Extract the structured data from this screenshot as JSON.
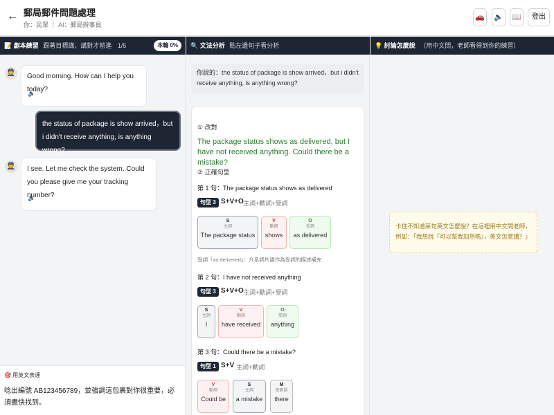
{
  "header": {
    "back_icon": "←",
    "title": "郵局郵件問題處理",
    "subtitle": "你：民眾 ｜ AI：郵局辦事員",
    "icons": [
      "🚗",
      "🔈",
      "📖"
    ],
    "logout_label": "登出"
  },
  "left": {
    "head_icon": "📝",
    "head_title": "劇本練習",
    "head_sub": "跟著目標講，講對才前進",
    "page": "1/5",
    "progress_label": "本輪 0%",
    "messages": [
      {
        "role": "ai",
        "avatar": "👮",
        "text": "Good morning. How can I help you today?",
        "speak": "🔈"
      },
      {
        "role": "user",
        "text": "the status of package is show arrived，but i didn't receive anything, is anything wrong?"
      },
      {
        "role": "ai",
        "avatar": "👮",
        "text": "I see. Let me check the system. Could you please give me your tracking number?",
        "speak": "🔈"
      }
    ],
    "english_label": "🎯 用英文表達",
    "english_prompt": "唸出編號 AB123456789，並強調這包裹對你很重要，必須盡快找到。"
  },
  "middle": {
    "head_icon": "🔍",
    "head_title": "文法分析",
    "head_sub": "點左邊句子看分析",
    "you_said": "你說的：the status of package is show arrived，but i didn't receive anything, is anything wrong?",
    "section1": "① 改對",
    "corrected": "The package status shows as delivered, but I have not received anything. Could there be a mistake?",
    "section2": "② 正確句型",
    "sentences": [
      {
        "label": "第 1 句：The package status shows as delivered",
        "pattern_tag": "句型 3",
        "formula": "S+V+O",
        "formula_cn": "主詞+動詞+受詞",
        "chips": [
          {
            "key": "S",
            "role": "主詞",
            "word": "The package status"
          },
          {
            "key": "V",
            "role": "動詞",
            "word": "shows"
          },
          {
            "key": "O",
            "role": "受詞",
            "word": "as delivered"
          }
        ],
        "note": "受詞「as delivered」：介系詞片語作為受詞的描述補充"
      },
      {
        "label": "第 2 句：I have not received anything",
        "pattern_tag": "句型 3",
        "formula": "S+V+O",
        "formula_cn": "主詞+動詞+受詞",
        "chips": [
          {
            "key": "S",
            "role": "主詞",
            "word": "I"
          },
          {
            "key": "V",
            "role": "動詞",
            "word": "have received"
          },
          {
            "key": "O",
            "role": "受詞",
            "word": "anything"
          }
        ]
      },
      {
        "label": "第 3 句：Could there be a mistake?",
        "pattern_tag": "句型 1",
        "formula": "S+V",
        "formula_cn": "主詞+動詞",
        "chips": [
          {
            "key": "V",
            "role": "動詞",
            "word": "Could be"
          },
          {
            "key": "S",
            "role": "主詞",
            "word": "a mistake"
          },
          {
            "key": "M",
            "role": "修飾語",
            "word": "there"
          }
        ]
      }
    ]
  },
  "right": {
    "head_icon": "💡",
    "head_title": "討論怎麼說",
    "head_sub": "（用中文問，老師看得到你的練習）",
    "hint": "卡住不知道某句英文怎麼說？在這裡用中文問老師，例如：「我想說『可以幫我加熱嗎』，英文怎麼講？」"
  },
  "colors": {
    "dark": "#1f2633",
    "corrected_green": "#2e7d32",
    "chip_subject": "#f3f4f6",
    "chip_verb": "#fff1f1",
    "chip_object": "#f0fbf0",
    "hint_bg": "#fffbeb"
  }
}
